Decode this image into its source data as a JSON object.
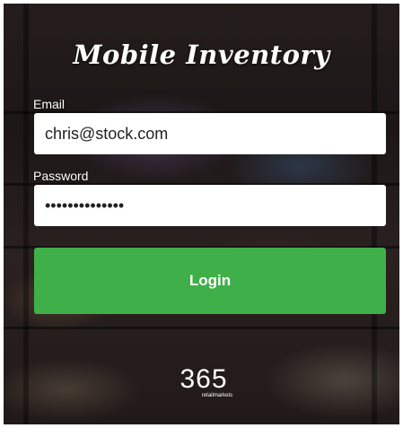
{
  "app": {
    "title": "Mobile Inventory"
  },
  "form": {
    "email_label": "Email",
    "email_value": "chris@stock.com",
    "password_label": "Password",
    "password_value": "••••••••••••••",
    "login_label": "Login"
  },
  "brand": {
    "logo_number": "365",
    "logo_sub": "retailmarkets"
  },
  "colors": {
    "login_button": "#3fb049",
    "input_background": "#ffffff",
    "text": "#ffffff"
  }
}
